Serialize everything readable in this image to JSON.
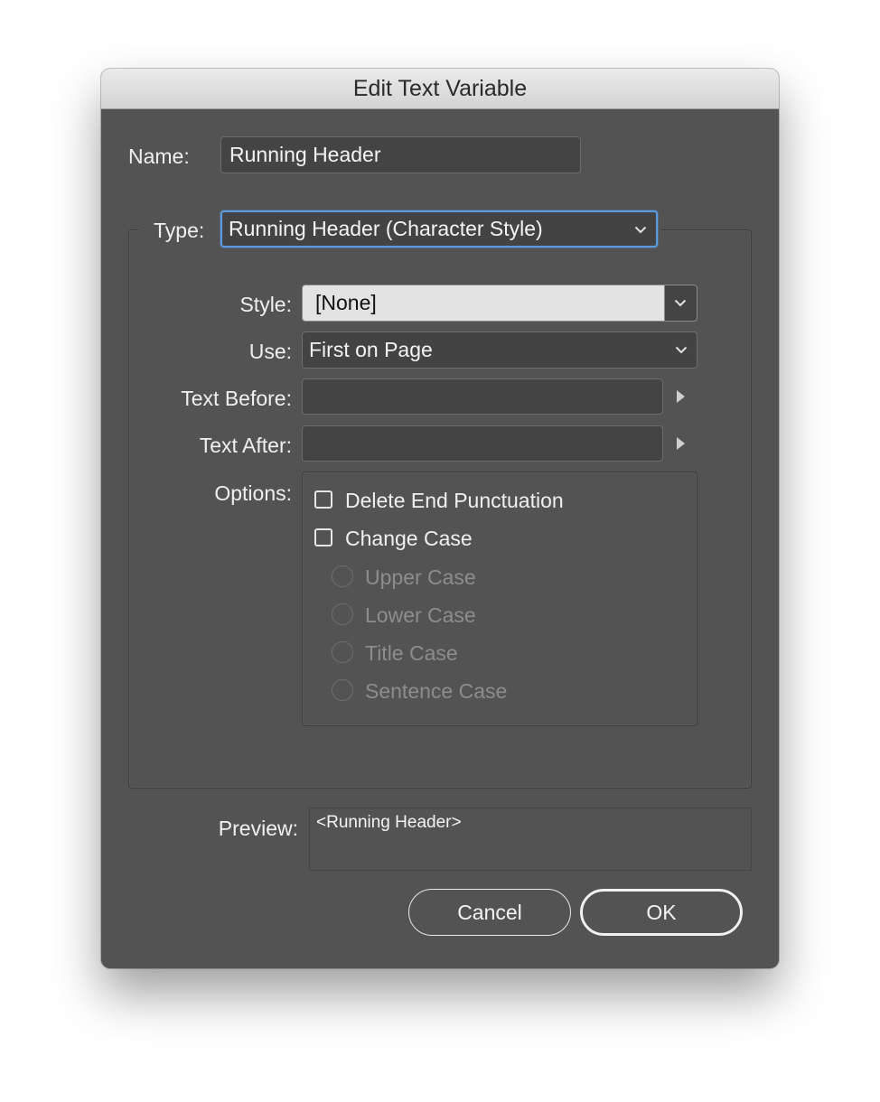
{
  "dialog": {
    "title": "Edit Text Variable"
  },
  "name": {
    "label": "Name:",
    "value": "Running Header"
  },
  "type": {
    "label": "Type:",
    "value": "Running Header (Character Style)"
  },
  "style": {
    "label": "Style:",
    "value": "[None]"
  },
  "use": {
    "label": "Use:",
    "value": "First on Page"
  },
  "text_before": {
    "label": "Text Before:",
    "value": ""
  },
  "text_after": {
    "label": "Text After:",
    "value": ""
  },
  "options": {
    "label": "Options:",
    "delete_end_punctuation": {
      "label": "Delete End Punctuation",
      "checked": false
    },
    "change_case": {
      "label": "Change Case",
      "checked": false
    },
    "case_options": [
      {
        "label": "Upper Case",
        "enabled": false
      },
      {
        "label": "Lower Case",
        "enabled": false
      },
      {
        "label": "Title Case",
        "enabled": false
      },
      {
        "label": "Sentence Case",
        "enabled": false
      }
    ]
  },
  "preview": {
    "label": "Preview:",
    "value": "<Running Header>"
  },
  "buttons": {
    "cancel": "Cancel",
    "ok": "OK"
  },
  "icons": {
    "dropdown": "chevron-down-icon",
    "flyout": "triangle-right-icon"
  },
  "colors": {
    "dialog_bg": "#535353",
    "focus_ring": "#5b9be0"
  }
}
